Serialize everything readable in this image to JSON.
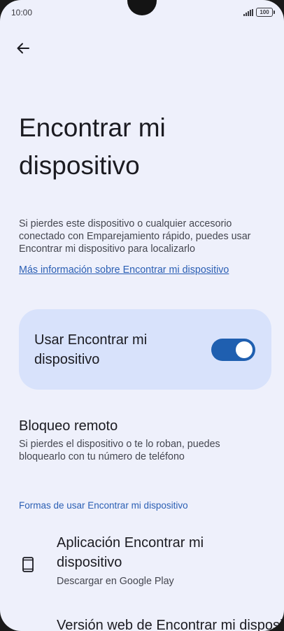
{
  "status_bar": {
    "time": "10:00",
    "battery": "100"
  },
  "icons": {
    "back": "arrow-left-icon",
    "phone": "smartphone-icon",
    "signal": "signal-icon",
    "battery": "battery-icon"
  },
  "header": {
    "title": "Encontrar mi dispositivo"
  },
  "intro": {
    "description": "Si pierdes este dispositivo o cualquier accesorio conectado con Emparejamiento rápido, puedes usar Encontrar mi dispositivo para localizarlo",
    "link_label": "Más información sobre Encontrar mi dispositivo"
  },
  "main_toggle": {
    "label": "Usar Encontrar mi dispositivo",
    "enabled": true
  },
  "remote_lock": {
    "title": "Bloqueo remoto",
    "subtitle": "Si pierdes el dispositivo o te lo roban, puedes bloquearlo con tu número de teléfono"
  },
  "ways_section": {
    "header": "Formas de usar Encontrar mi dispositivo",
    "items": [
      {
        "title": "Aplicación Encontrar mi dispositivo",
        "subtitle": "Descargar en Google Play"
      },
      {
        "title": "Versión web de Encontrar mi dispositivo"
      }
    ]
  },
  "colors": {
    "background": "#eef0fb",
    "card": "#d8e2fb",
    "accent": "#1f5fb0",
    "link": "#2b5fb4"
  }
}
